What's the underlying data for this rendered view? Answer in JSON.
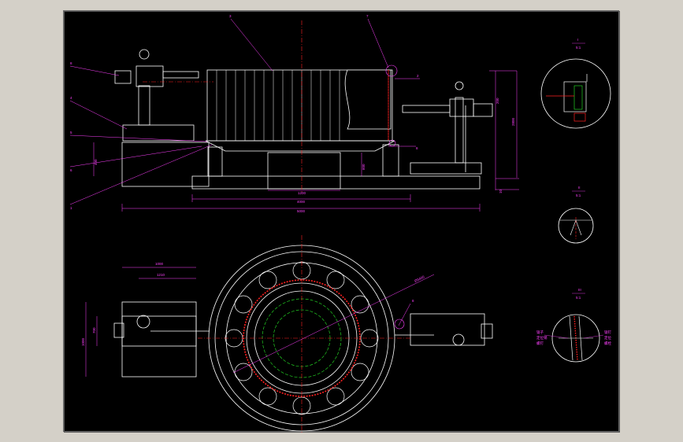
{
  "drawing": {
    "colors": {
      "background": "#000000",
      "frame": "#6a6a6a",
      "geometry": "#ffffff",
      "dimension": "#ff40ff",
      "centerline": "#ff2020",
      "hidden": "#22cc22",
      "label": "#ffff00"
    },
    "front_view": {
      "callouts": [
        "8",
        "4",
        "5",
        "6",
        "1",
        "3",
        "7",
        "2",
        "8"
      ],
      "dims": {
        "bottom_overall": "5000",
        "bottom_mid": "4000",
        "base_width": "1200",
        "total_height": "2800",
        "right_small": "10",
        "left_height": "400",
        "mid_height": "600",
        "arm_size": "200"
      }
    },
    "plan_view": {
      "dims": {
        "top_outer": "1000",
        "top_inner": "1210",
        "left_height": "1000",
        "left_inner": "700",
        "diameter": "Ø3400"
      },
      "callout": "8"
    },
    "detail_views": [
      {
        "id": "detail-i",
        "label": "I",
        "scale": "5:1"
      },
      {
        "id": "detail-ii",
        "label": "II",
        "scale": "5:1"
      },
      {
        "id": "detail-iii",
        "label": "III",
        "scale": "5:1"
      }
    ],
    "detail_iii_notes": {
      "left": [
        "锯子",
        "定位销",
        "螺钉"
      ],
      "right": [
        "锯钉",
        "定位",
        "螺栓"
      ]
    }
  }
}
